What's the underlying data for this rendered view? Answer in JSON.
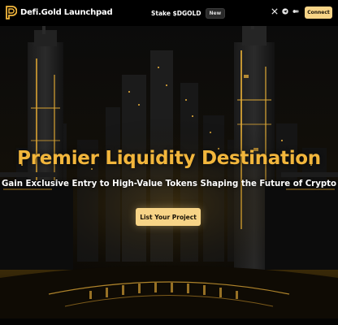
{
  "header": {
    "brand": "Defi.Gold Launchpad",
    "stake_label": "Stake $DGOLD",
    "stake_badge": "New",
    "socials": [
      "x-icon",
      "telegram-icon",
      "medium-icon"
    ],
    "connect_label": "Connect"
  },
  "hero": {
    "title": "Premier Liquidity Destination",
    "subtitle": "Gain Exclusive Entry to High-Value Tokens Shaping the Future of Crypto",
    "cta_label": "List Your Project"
  },
  "colors": {
    "accent_gold": "#f2b63c",
    "button_gold": "#f7d487",
    "background": "#050505"
  }
}
